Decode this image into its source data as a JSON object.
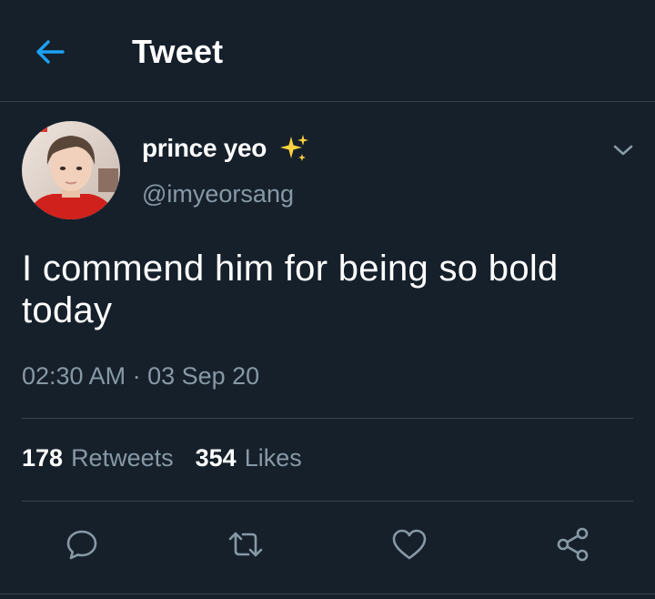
{
  "header": {
    "title": "Tweet",
    "back_icon": "arrow-left-icon",
    "accent_color": "#1da1f2"
  },
  "tweet": {
    "display_name": "prince yeo",
    "name_emoji_icon": "sparkles-icon",
    "handle": "@imyeorsang",
    "text": "I commend him for being so bold today",
    "timestamp": "02:30 AM · 03 Sep 20",
    "retweets": "178",
    "retweets_label": "Retweets",
    "likes": "354",
    "likes_label": "Likes"
  },
  "actions": [
    {
      "icon": "reply-icon"
    },
    {
      "icon": "retweet-icon"
    },
    {
      "icon": "like-icon"
    },
    {
      "icon": "share-icon"
    }
  ],
  "colors": {
    "background": "#15202b",
    "secondary_text": "#8899a6",
    "divider": "#38444d"
  }
}
